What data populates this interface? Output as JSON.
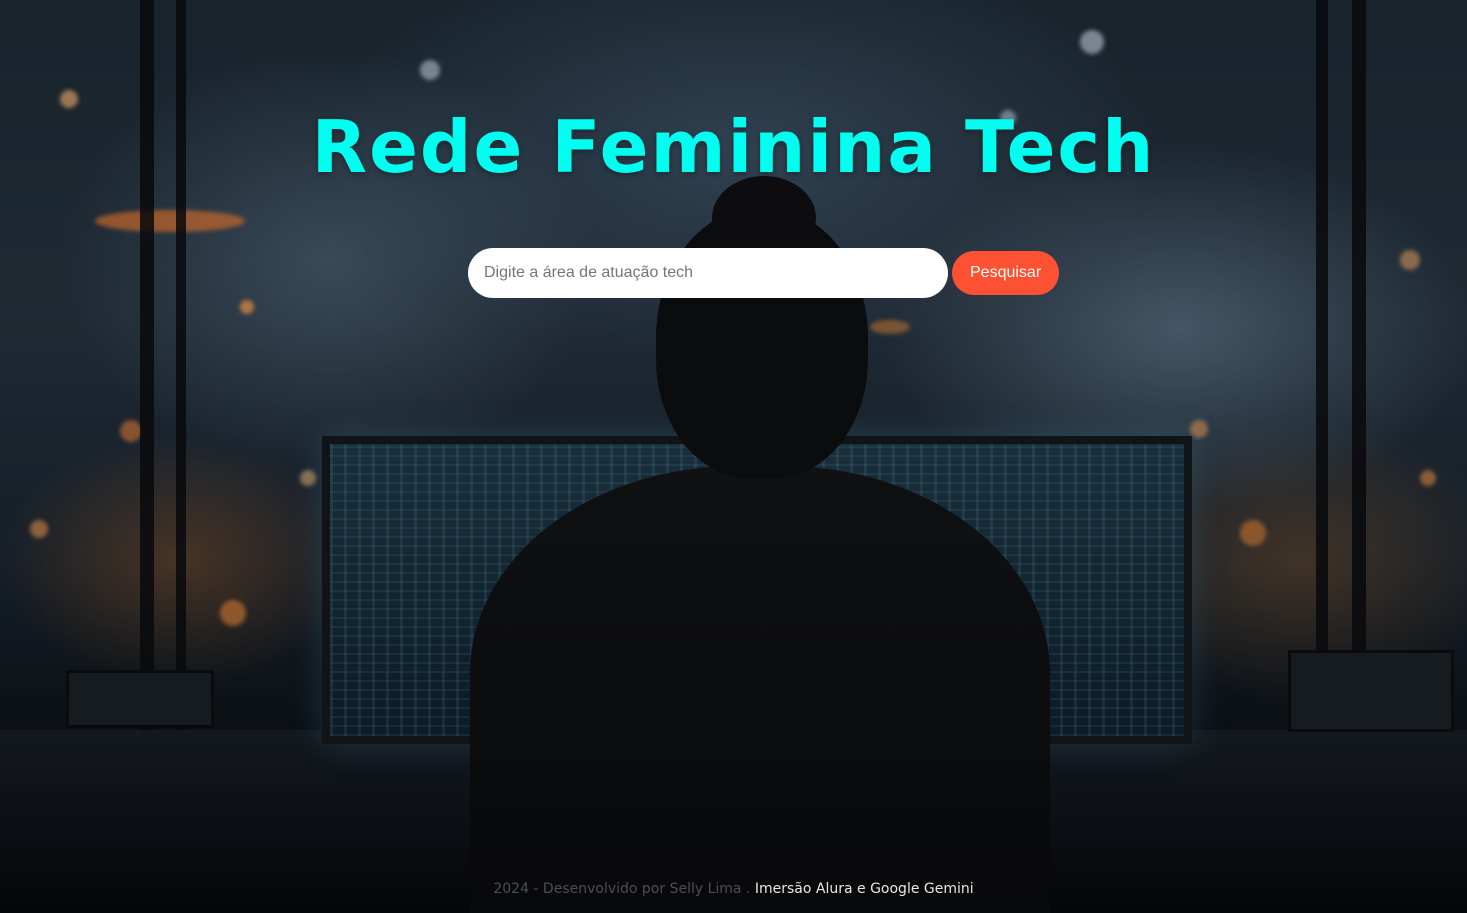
{
  "header": {
    "title": "Rede Feminina Tech"
  },
  "search": {
    "placeholder": "Digite a área de atuação tech",
    "value": "",
    "button_label": "Pesquisar"
  },
  "footer": {
    "credits": "2024 - Desenvolvido por Selly Lima .",
    "link_label": "Imersão Alura e Google Gemini"
  },
  "colors": {
    "title": "#00fff0",
    "button": "#fe5133",
    "input_background": "#ffffff"
  },
  "background": {
    "icon": "woman-at-computer-city-night-photo"
  }
}
